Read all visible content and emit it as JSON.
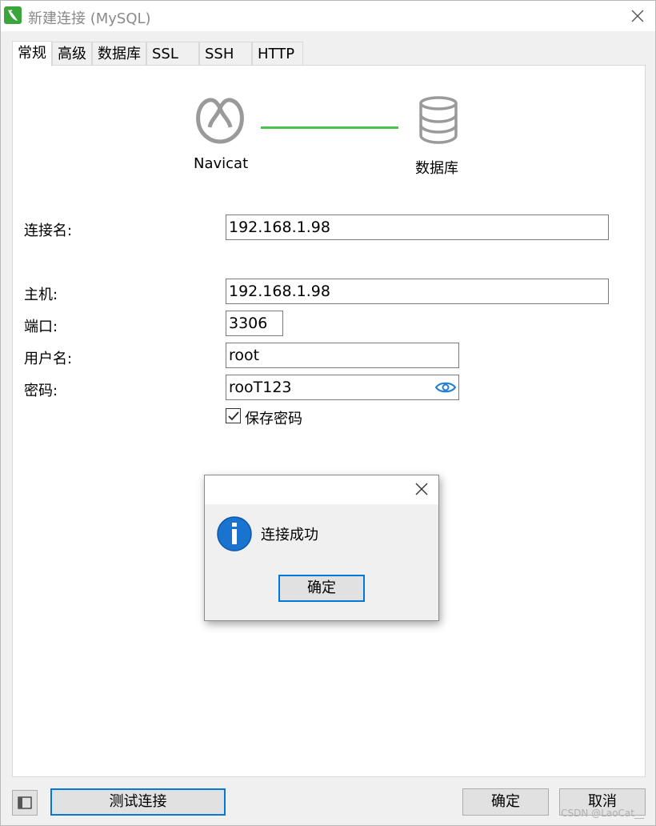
{
  "window": {
    "title": "新建连接 (MySQL)"
  },
  "tabs": [
    {
      "label": "常规",
      "active": true
    },
    {
      "label": "高级"
    },
    {
      "label": "数据库"
    },
    {
      "label": "SSL"
    },
    {
      "label": "SSH"
    },
    {
      "label": "HTTP"
    }
  ],
  "graphic": {
    "left_label": "Navicat",
    "right_label": "数据库",
    "link_color": "#4cc24c"
  },
  "form": {
    "connection_name": {
      "label": "连接名:",
      "value": "192.168.1.98"
    },
    "host": {
      "label": "主机:",
      "value": "192.168.1.98"
    },
    "port": {
      "label": "端口:",
      "value": "3306"
    },
    "username": {
      "label": "用户名:",
      "value": "root"
    },
    "password": {
      "label": "密码:",
      "value": "rooT123"
    },
    "save_password": {
      "label": "保存密码",
      "checked": true
    }
  },
  "dialog": {
    "icon": "info-icon",
    "message": "连接成功",
    "ok_label": "确定"
  },
  "footer": {
    "test_label": "测试连接",
    "ok_label": "确定",
    "cancel_label": "取消"
  },
  "watermark": "CSDN @LaoCat__"
}
